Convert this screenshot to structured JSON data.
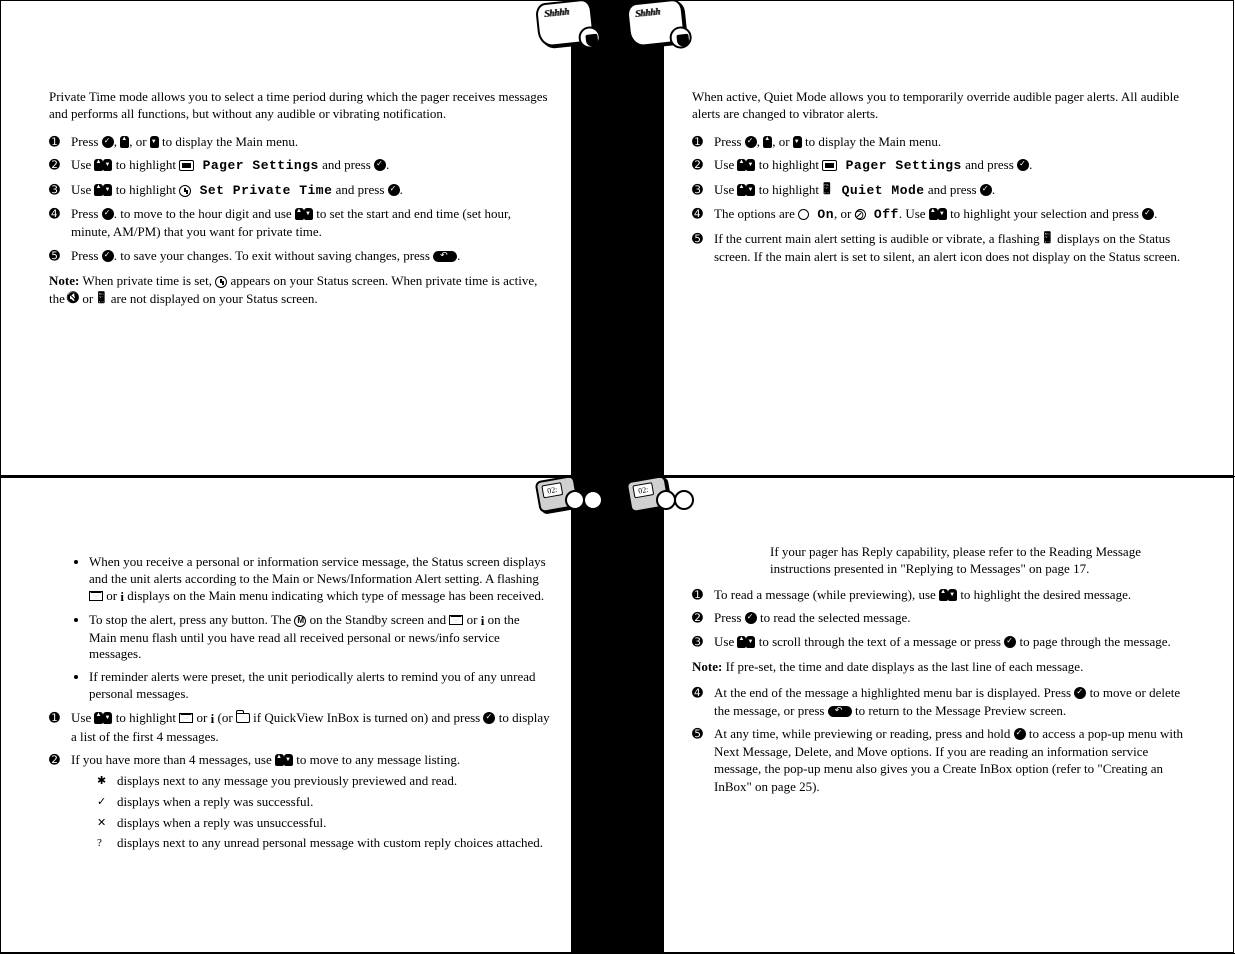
{
  "pages": {
    "p1": {
      "intro": "Private Time mode allows you to select a time period during which the pager receives messages and performs all functions, but without any audible or vibrating notification.",
      "s1a": "Press ",
      "s1b": ", ",
      "s1c": ", or ",
      "s1d": " to display the Main menu.",
      "s2a": "Use ",
      "s2b": " to highlight ",
      "s2c": " Pager Settings",
      "s2d": " and press ",
      "s2e": ".",
      "s3a": "Use ",
      "s3b": " to highlight ",
      "s3c": " Set Private Time",
      "s3d": " and press ",
      "s3e": ".",
      "s4a": "Press ",
      "s4b": ". to move to the hour digit and use ",
      "s4c": " to set the start and end time (set hour, minute, AM/PM) that you want for private time.",
      "s5a": "Press ",
      "s5b": ". to save your changes. To exit without saving changes, press ",
      "s5c": ".",
      "noteLabel": "Note:",
      "note": " When private time is set, ",
      "note2": " appears on your Status screen. When private time is active, the ",
      "note3": " or ",
      "note4": " are not displayed on your Status screen."
    },
    "p2": {
      "intro": "When active, Quiet Mode allows you to temporarily override audible pager alerts. All audible alerts are changed to vibrator alerts.",
      "s1a": "Press ",
      "s1b": ", ",
      "s1c": ", or ",
      "s1d": " to display the Main menu.",
      "s2a": "Use ",
      "s2b": " to highlight ",
      "s2c": " Pager Settings",
      "s2d": " and press ",
      "s2e": ".",
      "s3a": "Use ",
      "s3b": " to highlight ",
      "s3c": " Quiet Mode",
      "s3d": " and press ",
      "s3e": ".",
      "s4a": "The options are ",
      "s4b": " On",
      "s4c": ", or ",
      "s4d": " Off",
      "s4e": ". Use ",
      "s4f": " to highlight your selection and press ",
      "s4g": ".",
      "s5a": "If the current main alert setting is audible or vibrate, a flashing ",
      "s5b": " displays on the Status screen. If the main alert is set to silent, an alert icon does not display on the Status screen."
    },
    "p3": {
      "b1": "When you receive a personal or information service message, the Status screen displays and the unit alerts according to the Main or News/Information Alert setting. A flashing ",
      "b1b": " or ",
      "b1c": " displays on the Main menu indicating which type of message has been received.",
      "b2": "To stop the alert, press any button. The ",
      "b2b": " on the Standby screen and ",
      "b2c": " or ",
      "b2d": " on the Main menu flash until you have read all received personal or news/info service messages.",
      "b3": "If reminder alerts were preset, the unit periodically alerts to remind you of any unread personal messages.",
      "s1a": "Use ",
      "s1b": " to highlight ",
      "s1c": " or ",
      "s1d": " (or ",
      "s1e": " if QuickView InBox is turned on) and press ",
      "s1f": " to display a list of the first 4 messages.",
      "s2a": "If you have more than 4 messages, use ",
      "s2b": " to move to any message listing.",
      "sub1": "displays next to any message you previously previewed and read.",
      "sub2": "displays when a reply was successful.",
      "sub3": "displays when a reply was unsuccessful.",
      "sub4": "displays next to any unread personal message with custom reply choices attached."
    },
    "p4": {
      "intro": "If your pager has Reply capability, please refer to the Reading Message instructions presented in \"Replying to Messages\" on page 17.",
      "s1a": "To read a message (while previewing), use ",
      "s1b": " to highlight the desired message.",
      "s2a": "Press ",
      "s2b": " to read the selected message.",
      "s3a": "Use ",
      "s3b": " to scroll through the text of a message or press ",
      "s3c": " to page through the message.",
      "noteLabel": "Note:",
      "note": " If pre-set, the time and date displays as the last line of each message.",
      "s4a": "At the end of the message a highlighted menu bar is displayed. Press ",
      "s4b": " to move or delete the message, or press ",
      "s4c": " to return to the Message Preview screen.",
      "s5a": "At any time, while previewing or reading, press and hold ",
      "s5b": " to access a pop-up menu with Next Message, Delete, and Move options. If you are reading an information service message, the pop-up menu also gives you a Create InBox option (refer to \"Creating an InBox\" on page 25)."
    }
  }
}
